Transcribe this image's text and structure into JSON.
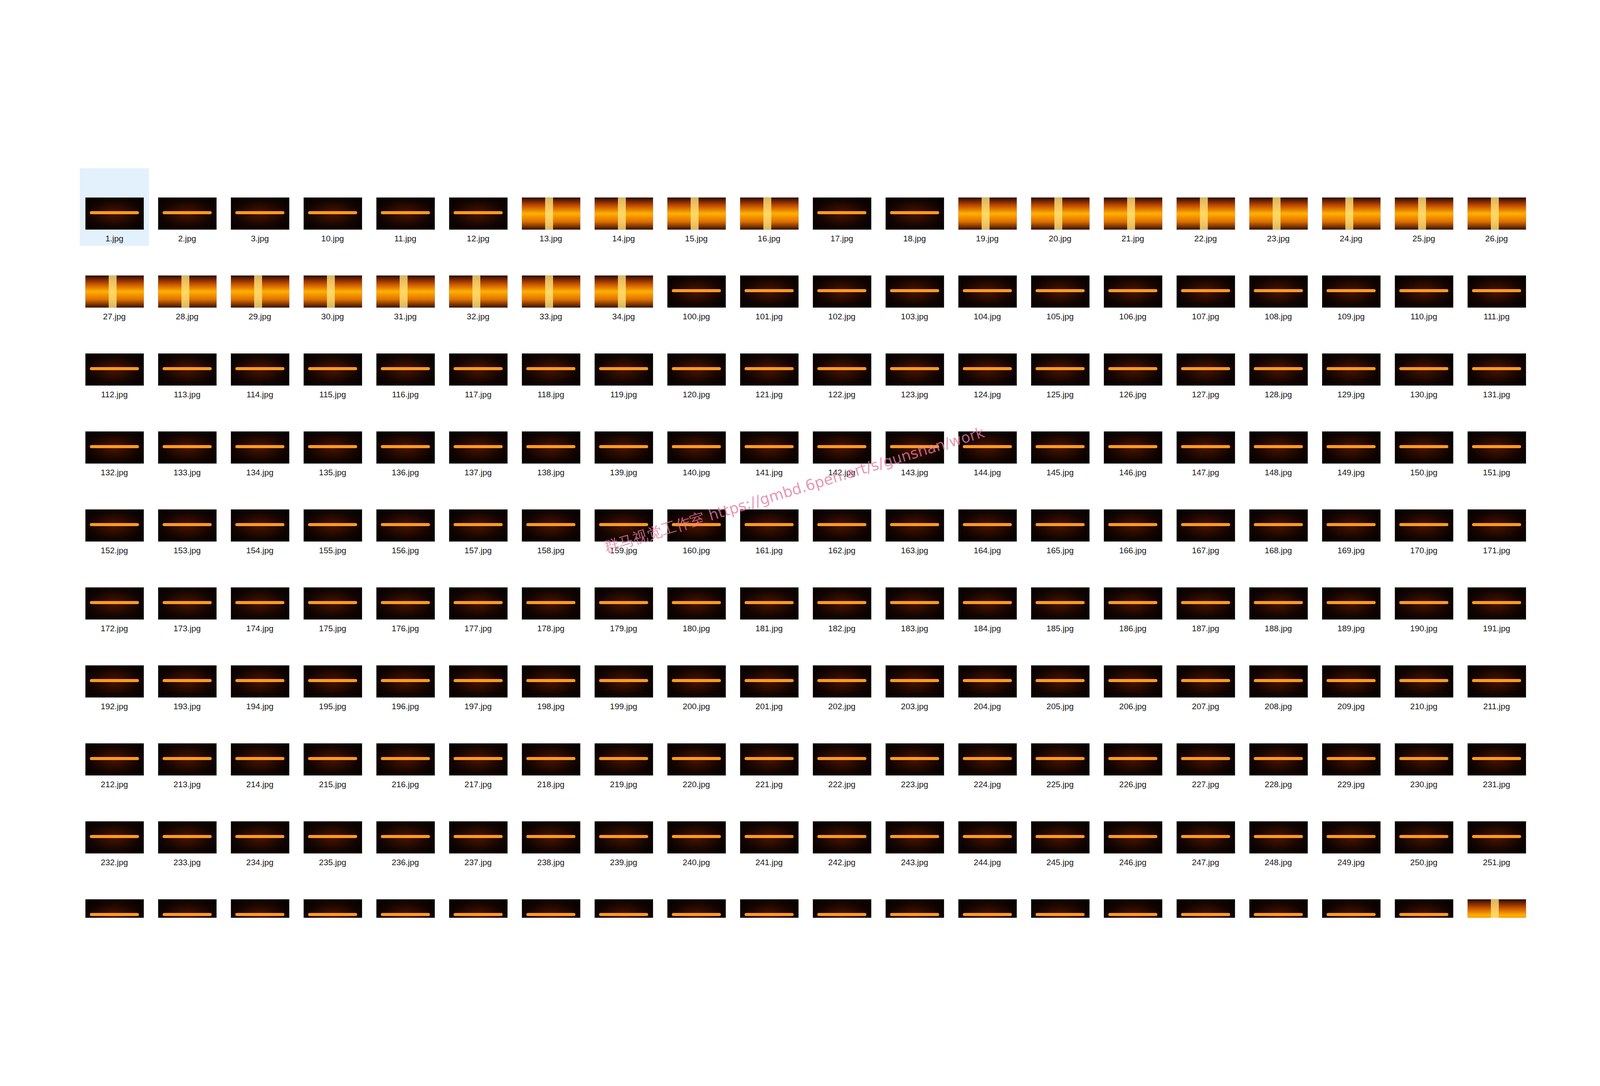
{
  "items": [
    {
      "label": "1.jpg",
      "selected": true,
      "kind": "dark"
    },
    {
      "label": "2.jpg",
      "selected": false,
      "kind": "dark"
    },
    {
      "label": "3.jpg",
      "selected": false,
      "kind": "dark"
    },
    {
      "label": "10.jpg",
      "selected": false,
      "kind": "dark"
    },
    {
      "label": "11.jpg",
      "selected": false,
      "kind": "dark"
    },
    {
      "label": "12.jpg",
      "selected": false,
      "kind": "dark"
    },
    {
      "label": "13.jpg",
      "selected": false,
      "kind": "bright"
    },
    {
      "label": "14.jpg",
      "selected": false,
      "kind": "bright"
    },
    {
      "label": "15.jpg",
      "selected": false,
      "kind": "bright"
    },
    {
      "label": "16.jpg",
      "selected": false,
      "kind": "bright"
    },
    {
      "label": "17.jpg",
      "selected": false,
      "kind": "dark"
    },
    {
      "label": "18.jpg",
      "selected": false,
      "kind": "dark"
    },
    {
      "label": "19.jpg",
      "selected": false,
      "kind": "bright"
    },
    {
      "label": "20.jpg",
      "selected": false,
      "kind": "bright"
    },
    {
      "label": "21.jpg",
      "selected": false,
      "kind": "bright"
    },
    {
      "label": "22.jpg",
      "selected": false,
      "kind": "bright"
    },
    {
      "label": "23.jpg",
      "selected": false,
      "kind": "bright"
    },
    {
      "label": "24.jpg",
      "selected": false,
      "kind": "bright"
    },
    {
      "label": "25.jpg",
      "selected": false,
      "kind": "bright"
    },
    {
      "label": "26.jpg",
      "selected": false,
      "kind": "bright"
    },
    {
      "label": "27.jpg",
      "selected": false,
      "kind": "bright"
    },
    {
      "label": "28.jpg",
      "selected": false,
      "kind": "bright"
    },
    {
      "label": "29.jpg",
      "selected": false,
      "kind": "bright"
    },
    {
      "label": "30.jpg",
      "selected": false,
      "kind": "bright"
    },
    {
      "label": "31.jpg",
      "selected": false,
      "kind": "bright"
    },
    {
      "label": "32.jpg",
      "selected": false,
      "kind": "bright"
    },
    {
      "label": "33.jpg",
      "selected": false,
      "kind": "bright"
    },
    {
      "label": "34.jpg",
      "selected": false,
      "kind": "bright"
    },
    {
      "label": "100.jpg",
      "selected": false,
      "kind": "dark"
    },
    {
      "label": "101.jpg",
      "selected": false,
      "kind": "dark"
    },
    {
      "label": "102.jpg",
      "selected": false,
      "kind": "dark"
    },
    {
      "label": "103.jpg",
      "selected": false,
      "kind": "dark"
    },
    {
      "label": "104.jpg",
      "selected": false,
      "kind": "dark"
    },
    {
      "label": "105.jpg",
      "selected": false,
      "kind": "dark"
    },
    {
      "label": "106.jpg",
      "selected": false,
      "kind": "dark"
    },
    {
      "label": "107.jpg",
      "selected": false,
      "kind": "dark"
    },
    {
      "label": "108.jpg",
      "selected": false,
      "kind": "dark"
    },
    {
      "label": "109.jpg",
      "selected": false,
      "kind": "dark"
    },
    {
      "label": "110.jpg",
      "selected": false,
      "kind": "dark"
    },
    {
      "label": "111.jpg",
      "selected": false,
      "kind": "dark"
    },
    {
      "label": "112.jpg",
      "selected": false,
      "kind": "dark"
    },
    {
      "label": "113.jpg",
      "selected": false,
      "kind": "dark"
    },
    {
      "label": "114.jpg",
      "selected": false,
      "kind": "dark"
    },
    {
      "label": "115.jpg",
      "selected": false,
      "kind": "dark"
    },
    {
      "label": "116.jpg",
      "selected": false,
      "kind": "dark"
    },
    {
      "label": "117.jpg",
      "selected": false,
      "kind": "dark"
    },
    {
      "label": "118.jpg",
      "selected": false,
      "kind": "dark"
    },
    {
      "label": "119.jpg",
      "selected": false,
      "kind": "dark"
    },
    {
      "label": "120.jpg",
      "selected": false,
      "kind": "dark"
    },
    {
      "label": "121.jpg",
      "selected": false,
      "kind": "dark"
    },
    {
      "label": "122.jpg",
      "selected": false,
      "kind": "dark"
    },
    {
      "label": "123.jpg",
      "selected": false,
      "kind": "dark"
    },
    {
      "label": "124.jpg",
      "selected": false,
      "kind": "dark"
    },
    {
      "label": "125.jpg",
      "selected": false,
      "kind": "dark"
    },
    {
      "label": "126.jpg",
      "selected": false,
      "kind": "dark"
    },
    {
      "label": "127.jpg",
      "selected": false,
      "kind": "dark"
    },
    {
      "label": "128.jpg",
      "selected": false,
      "kind": "dark"
    },
    {
      "label": "129.jpg",
      "selected": false,
      "kind": "dark"
    },
    {
      "label": "130.jpg",
      "selected": false,
      "kind": "dark"
    },
    {
      "label": "131.jpg",
      "selected": false,
      "kind": "dark"
    },
    {
      "label": "132.jpg",
      "selected": false,
      "kind": "dark"
    },
    {
      "label": "133.jpg",
      "selected": false,
      "kind": "dark"
    },
    {
      "label": "134.jpg",
      "selected": false,
      "kind": "dark"
    },
    {
      "label": "135.jpg",
      "selected": false,
      "kind": "dark"
    },
    {
      "label": "136.jpg",
      "selected": false,
      "kind": "dark"
    },
    {
      "label": "137.jpg",
      "selected": false,
      "kind": "dark"
    },
    {
      "label": "138.jpg",
      "selected": false,
      "kind": "dark"
    },
    {
      "label": "139.jpg",
      "selected": false,
      "kind": "dark"
    },
    {
      "label": "140.jpg",
      "selected": false,
      "kind": "dark"
    },
    {
      "label": "141.jpg",
      "selected": false,
      "kind": "dark"
    },
    {
      "label": "142.jpg",
      "selected": false,
      "kind": "dark"
    },
    {
      "label": "143.jpg",
      "selected": false,
      "kind": "dark"
    },
    {
      "label": "144.jpg",
      "selected": false,
      "kind": "dark"
    },
    {
      "label": "145.jpg",
      "selected": false,
      "kind": "dark"
    },
    {
      "label": "146.jpg",
      "selected": false,
      "kind": "dark"
    },
    {
      "label": "147.jpg",
      "selected": false,
      "kind": "dark"
    },
    {
      "label": "148.jpg",
      "selected": false,
      "kind": "dark"
    },
    {
      "label": "149.jpg",
      "selected": false,
      "kind": "dark"
    },
    {
      "label": "150.jpg",
      "selected": false,
      "kind": "dark"
    },
    {
      "label": "151.jpg",
      "selected": false,
      "kind": "dark"
    },
    {
      "label": "152.jpg",
      "selected": false,
      "kind": "dark"
    },
    {
      "label": "153.jpg",
      "selected": false,
      "kind": "dark"
    },
    {
      "label": "154.jpg",
      "selected": false,
      "kind": "dark"
    },
    {
      "label": "155.jpg",
      "selected": false,
      "kind": "dark"
    },
    {
      "label": "156.jpg",
      "selected": false,
      "kind": "dark"
    },
    {
      "label": "157.jpg",
      "selected": false,
      "kind": "dark"
    },
    {
      "label": "158.jpg",
      "selected": false,
      "kind": "dark"
    },
    {
      "label": "159.jpg",
      "selected": false,
      "kind": "dark"
    },
    {
      "label": "160.jpg",
      "selected": false,
      "kind": "dark"
    },
    {
      "label": "161.jpg",
      "selected": false,
      "kind": "dark"
    },
    {
      "label": "162.jpg",
      "selected": false,
      "kind": "dark"
    },
    {
      "label": "163.jpg",
      "selected": false,
      "kind": "dark"
    },
    {
      "label": "164.jpg",
      "selected": false,
      "kind": "dark"
    },
    {
      "label": "165.jpg",
      "selected": false,
      "kind": "dark"
    },
    {
      "label": "166.jpg",
      "selected": false,
      "kind": "dark"
    },
    {
      "label": "167.jpg",
      "selected": false,
      "kind": "dark"
    },
    {
      "label": "168.jpg",
      "selected": false,
      "kind": "dark"
    },
    {
      "label": "169.jpg",
      "selected": false,
      "kind": "dark"
    },
    {
      "label": "170.jpg",
      "selected": false,
      "kind": "dark"
    },
    {
      "label": "171.jpg",
      "selected": false,
      "kind": "dark"
    },
    {
      "label": "172.jpg",
      "selected": false,
      "kind": "dark"
    },
    {
      "label": "173.jpg",
      "selected": false,
      "kind": "dark"
    },
    {
      "label": "174.jpg",
      "selected": false,
      "kind": "dark"
    },
    {
      "label": "175.jpg",
      "selected": false,
      "kind": "dark"
    },
    {
      "label": "176.jpg",
      "selected": false,
      "kind": "dark"
    },
    {
      "label": "177.jpg",
      "selected": false,
      "kind": "dark"
    },
    {
      "label": "178.jpg",
      "selected": false,
      "kind": "dark"
    },
    {
      "label": "179.jpg",
      "selected": false,
      "kind": "dark"
    },
    {
      "label": "180.jpg",
      "selected": false,
      "kind": "dark"
    },
    {
      "label": "181.jpg",
      "selected": false,
      "kind": "dark"
    },
    {
      "label": "182.jpg",
      "selected": false,
      "kind": "dark"
    },
    {
      "label": "183.jpg",
      "selected": false,
      "kind": "dark"
    },
    {
      "label": "184.jpg",
      "selected": false,
      "kind": "dark"
    },
    {
      "label": "185.jpg",
      "selected": false,
      "kind": "dark"
    },
    {
      "label": "186.jpg",
      "selected": false,
      "kind": "dark"
    },
    {
      "label": "187.jpg",
      "selected": false,
      "kind": "dark"
    },
    {
      "label": "188.jpg",
      "selected": false,
      "kind": "dark"
    },
    {
      "label": "189.jpg",
      "selected": false,
      "kind": "dark"
    },
    {
      "label": "190.jpg",
      "selected": false,
      "kind": "dark"
    },
    {
      "label": "191.jpg",
      "selected": false,
      "kind": "dark"
    },
    {
      "label": "192.jpg",
      "selected": false,
      "kind": "dark"
    },
    {
      "label": "193.jpg",
      "selected": false,
      "kind": "dark"
    },
    {
      "label": "194.jpg",
      "selected": false,
      "kind": "dark"
    },
    {
      "label": "195.jpg",
      "selected": false,
      "kind": "dark"
    },
    {
      "label": "196.jpg",
      "selected": false,
      "kind": "dark"
    },
    {
      "label": "197.jpg",
      "selected": false,
      "kind": "dark"
    },
    {
      "label": "198.jpg",
      "selected": false,
      "kind": "dark"
    },
    {
      "label": "199.jpg",
      "selected": false,
      "kind": "dark"
    },
    {
      "label": "200.jpg",
      "selected": false,
      "kind": "dark"
    },
    {
      "label": "201.jpg",
      "selected": false,
      "kind": "dark"
    },
    {
      "label": "202.jpg",
      "selected": false,
      "kind": "dark"
    },
    {
      "label": "203.jpg",
      "selected": false,
      "kind": "dark"
    },
    {
      "label": "204.jpg",
      "selected": false,
      "kind": "dark"
    },
    {
      "label": "205.jpg",
      "selected": false,
      "kind": "dark"
    },
    {
      "label": "206.jpg",
      "selected": false,
      "kind": "dark"
    },
    {
      "label": "207.jpg",
      "selected": false,
      "kind": "dark"
    },
    {
      "label": "208.jpg",
      "selected": false,
      "kind": "dark"
    },
    {
      "label": "209.jpg",
      "selected": false,
      "kind": "dark"
    },
    {
      "label": "210.jpg",
      "selected": false,
      "kind": "dark"
    },
    {
      "label": "211.jpg",
      "selected": false,
      "kind": "dark"
    },
    {
      "label": "212.jpg",
      "selected": false,
      "kind": "dark"
    },
    {
      "label": "213.jpg",
      "selected": false,
      "kind": "dark"
    },
    {
      "label": "214.jpg",
      "selected": false,
      "kind": "dark"
    },
    {
      "label": "215.jpg",
      "selected": false,
      "kind": "dark"
    },
    {
      "label": "216.jpg",
      "selected": false,
      "kind": "dark"
    },
    {
      "label": "217.jpg",
      "selected": false,
      "kind": "dark"
    },
    {
      "label": "218.jpg",
      "selected": false,
      "kind": "dark"
    },
    {
      "label": "219.jpg",
      "selected": false,
      "kind": "dark"
    },
    {
      "label": "220.jpg",
      "selected": false,
      "kind": "dark"
    },
    {
      "label": "221.jpg",
      "selected": false,
      "kind": "dark"
    },
    {
      "label": "222.jpg",
      "selected": false,
      "kind": "dark"
    },
    {
      "label": "223.jpg",
      "selected": false,
      "kind": "dark"
    },
    {
      "label": "224.jpg",
      "selected": false,
      "kind": "dark"
    },
    {
      "label": "225.jpg",
      "selected": false,
      "kind": "dark"
    },
    {
      "label": "226.jpg",
      "selected": false,
      "kind": "dark"
    },
    {
      "label": "227.jpg",
      "selected": false,
      "kind": "dark"
    },
    {
      "label": "228.jpg",
      "selected": false,
      "kind": "dark"
    },
    {
      "label": "229.jpg",
      "selected": false,
      "kind": "dark"
    },
    {
      "label": "230.jpg",
      "selected": false,
      "kind": "dark"
    },
    {
      "label": "231.jpg",
      "selected": false,
      "kind": "dark"
    },
    {
      "label": "232.jpg",
      "selected": false,
      "kind": "dark"
    },
    {
      "label": "233.jpg",
      "selected": false,
      "kind": "dark"
    },
    {
      "label": "234.jpg",
      "selected": false,
      "kind": "dark"
    },
    {
      "label": "235.jpg",
      "selected": false,
      "kind": "dark"
    },
    {
      "label": "236.jpg",
      "selected": false,
      "kind": "dark"
    },
    {
      "label": "237.jpg",
      "selected": false,
      "kind": "dark"
    },
    {
      "label": "238.jpg",
      "selected": false,
      "kind": "dark"
    },
    {
      "label": "239.jpg",
      "selected": false,
      "kind": "dark"
    },
    {
      "label": "240.jpg",
      "selected": false,
      "kind": "dark"
    },
    {
      "label": "241.jpg",
      "selected": false,
      "kind": "dark"
    },
    {
      "label": "242.jpg",
      "selected": false,
      "kind": "dark"
    },
    {
      "label": "243.jpg",
      "selected": false,
      "kind": "dark"
    },
    {
      "label": "244.jpg",
      "selected": false,
      "kind": "dark"
    },
    {
      "label": "245.jpg",
      "selected": false,
      "kind": "dark"
    },
    {
      "label": "246.jpg",
      "selected": false,
      "kind": "dark"
    },
    {
      "label": "247.jpg",
      "selected": false,
      "kind": "dark"
    },
    {
      "label": "248.jpg",
      "selected": false,
      "kind": "dark"
    },
    {
      "label": "249.jpg",
      "selected": false,
      "kind": "dark"
    },
    {
      "label": "250.jpg",
      "selected": false,
      "kind": "dark"
    },
    {
      "label": "251.jpg",
      "selected": false,
      "kind": "dark"
    }
  ],
  "cut_row": [
    {
      "kind": "dark"
    },
    {
      "kind": "dark"
    },
    {
      "kind": "dark"
    },
    {
      "kind": "dark"
    },
    {
      "kind": "dark"
    },
    {
      "kind": "dark"
    },
    {
      "kind": "dark"
    },
    {
      "kind": "dark"
    },
    {
      "kind": "dark"
    },
    {
      "kind": "dark"
    },
    {
      "kind": "dark"
    },
    {
      "kind": "dark"
    },
    {
      "kind": "dark"
    },
    {
      "kind": "dark"
    },
    {
      "kind": "dark"
    },
    {
      "kind": "dark"
    },
    {
      "kind": "dark"
    },
    {
      "kind": "dark"
    },
    {
      "kind": "dark"
    },
    {
      "kind": "bright"
    }
  ],
  "watermark": "群马视觉工作室 https://gmbd.6pen.art/s/gunshan/work"
}
